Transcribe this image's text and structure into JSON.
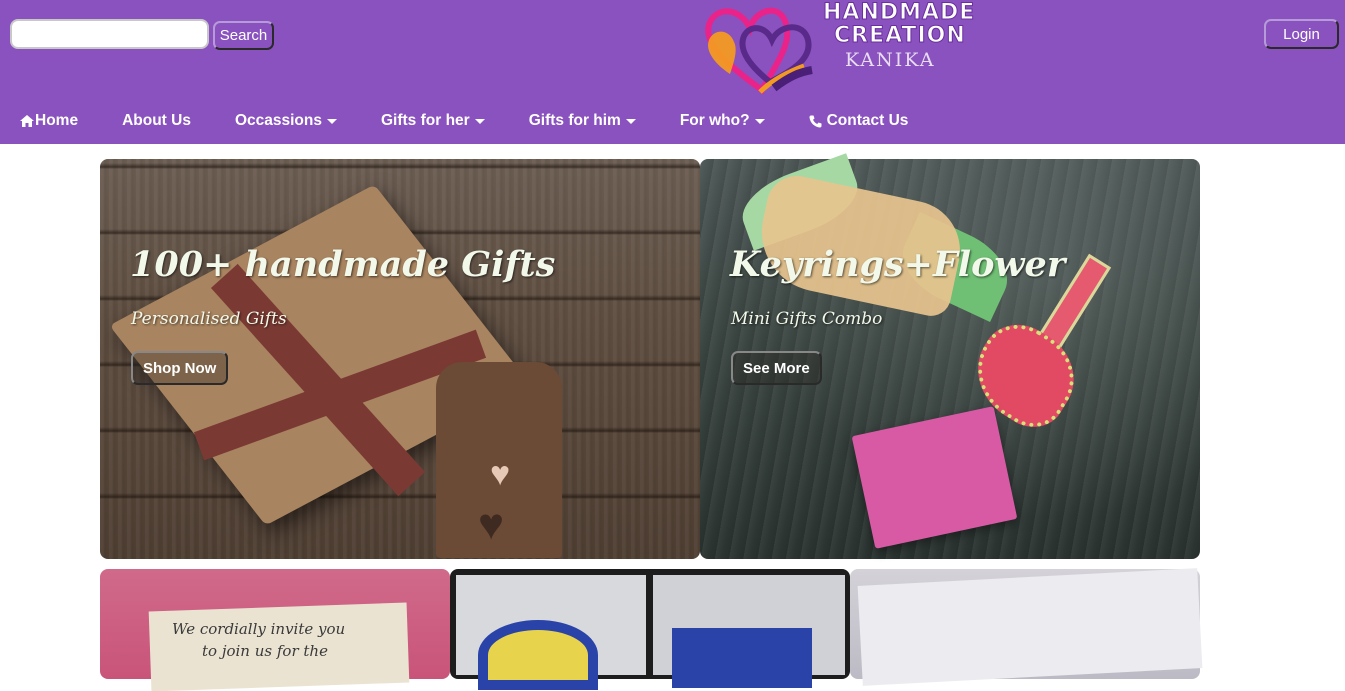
{
  "search": {
    "placeholder": "",
    "button_label": "Search"
  },
  "brand": {
    "line1": "HANDMADE",
    "line2": "CREATION",
    "line3": "KANIKA"
  },
  "login_label": "Login",
  "nav": [
    {
      "label": "Home",
      "icon": "home-icon",
      "dropdown": false
    },
    {
      "label": "About Us",
      "icon": "",
      "dropdown": false
    },
    {
      "label": "Occassions",
      "icon": "",
      "dropdown": true
    },
    {
      "label": "Gifts for her",
      "icon": "",
      "dropdown": true
    },
    {
      "label": "Gifts for him",
      "icon": "",
      "dropdown": true
    },
    {
      "label": "For who?",
      "icon": "",
      "dropdown": true
    },
    {
      "label": "Contact Us",
      "icon": "phone-icon",
      "dropdown": false
    }
  ],
  "slides": [
    {
      "title": "100+ handmade Gifts",
      "subtitle": "Personalised Gifts",
      "button": "Shop Now"
    },
    {
      "title": "Keyrings+Flower",
      "subtitle": "Mini Gifts Combo",
      "button": "See More"
    }
  ],
  "bottom_cards": {
    "invite_text_line1": "We cordially invite you",
    "invite_text_line2": "to join us for the"
  },
  "colors": {
    "header": "#8a52bf",
    "text_light": "#f3f9ea"
  }
}
